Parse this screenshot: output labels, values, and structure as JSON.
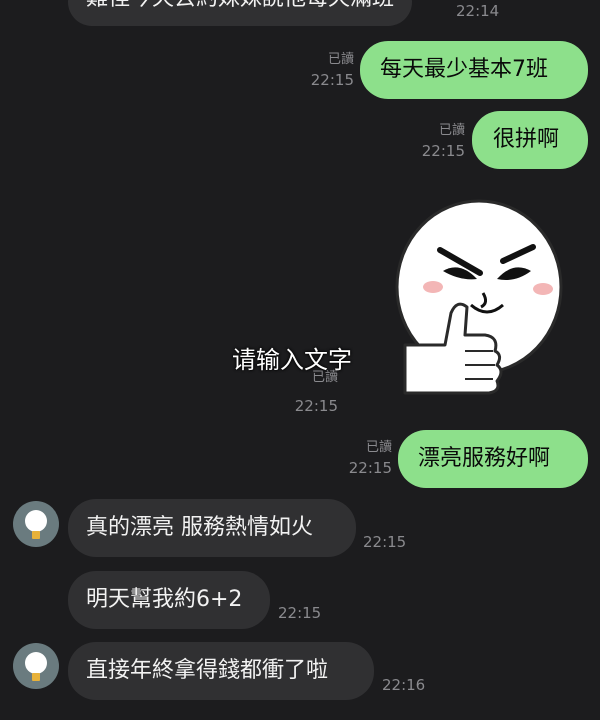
{
  "messages": {
    "m0": {
      "text": "難怪今天去約妹妹說他每天滿班",
      "time": "22:14"
    },
    "m1": {
      "text": "每天最少基本7班",
      "read": "已讀",
      "time": "22:15"
    },
    "m2": {
      "text": "很拼啊",
      "read": "已讀",
      "time": "22:15"
    },
    "sticker": {
      "read": "已讀",
      "time": "22:15"
    },
    "m3": {
      "text": "漂亮服務好啊",
      "read": "已讀",
      "time": "22:15"
    },
    "m4": {
      "text": "真的漂亮 服務熱情如火",
      "time": "22:15"
    },
    "m5": {
      "text": "明天幫我約6+2",
      "time": "22:15"
    },
    "m6": {
      "text": "直接年終拿得錢都衝了啦",
      "time": "22:16"
    }
  },
  "overlay": {
    "text": "请输入文字"
  },
  "colors": {
    "outgoing": "#8de08b",
    "incoming": "#303032",
    "background": "#1c1c1e"
  },
  "icons": {
    "avatar": "lightbulb-avatar-icon",
    "sticker": "thumbs-up-face-sticker"
  }
}
